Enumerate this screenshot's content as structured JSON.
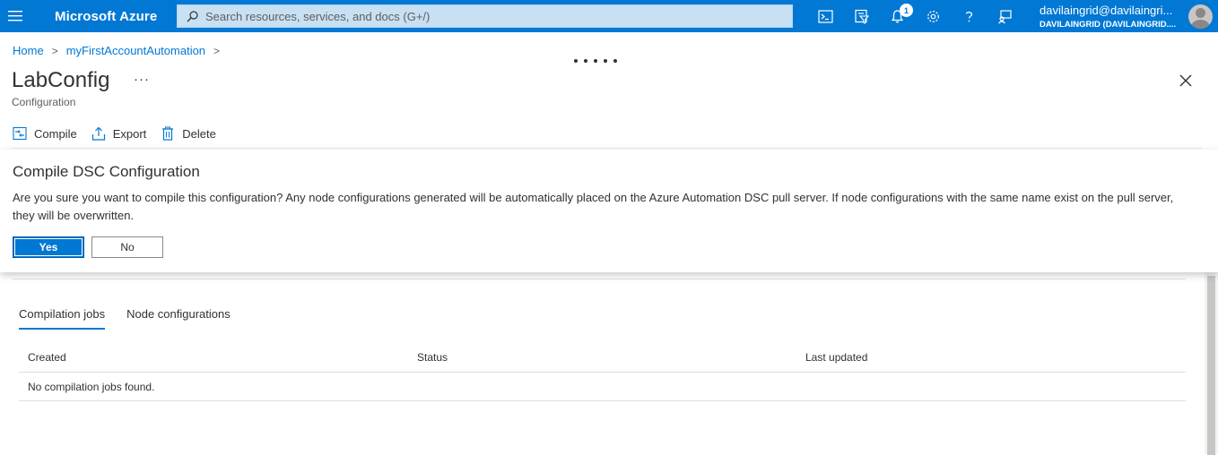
{
  "topbar": {
    "brand": "Microsoft Azure",
    "search_placeholder": "Search resources, services, and docs (G+/)",
    "notification_count": "1",
    "account_email": "davilaingrid@davilaingri...",
    "account_tenant": "DAVILAINGRID (DAVILAINGRID....",
    "icons": [
      "menu-icon",
      "cloud-shell-icon",
      "directory-filter-icon",
      "notifications-icon",
      "settings-icon",
      "help-icon",
      "feedback-icon"
    ]
  },
  "breadcrumb": {
    "items": [
      "Home",
      "myFirstAccountAutomation"
    ]
  },
  "header": {
    "title": "LabConfig",
    "more": "···",
    "subtitle": "Configuration"
  },
  "toolbar": {
    "compile_label": "Compile",
    "export_label": "Export",
    "delete_label": "Delete"
  },
  "dialog": {
    "title": "Compile DSC Configuration",
    "message": "Are you sure you want to compile this configuration? Any node configurations generated will be automatically placed on the Azure Automation DSC pull server. If node configurations with the same name exist on the pull server, they will be overwritten.",
    "yes_label": "Yes",
    "no_label": "No"
  },
  "tabs": [
    {
      "label": "Compilation jobs",
      "active": true
    },
    {
      "label": "Node configurations",
      "active": false
    }
  ],
  "grid": {
    "columns": [
      "Created",
      "Status",
      "Last updated"
    ],
    "empty_message": "No compilation jobs found."
  },
  "colors": {
    "accent": "#0078d4",
    "search_bg": "#c7e0f4"
  }
}
